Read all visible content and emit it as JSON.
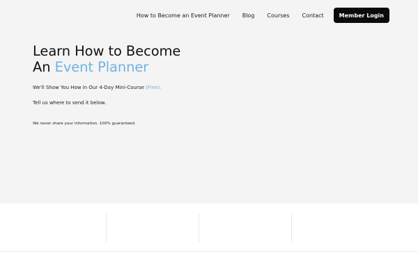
{
  "nav": {
    "links": [
      {
        "label": "How to Become an Event Planner"
      },
      {
        "label": "Blog"
      },
      {
        "label": "Courses"
      },
      {
        "label": "Contact"
      }
    ],
    "member_login": "Member Login"
  },
  "hero": {
    "headline_line1": "Learn How to Become",
    "headline_prefix": "An ",
    "headline_accent": "Event Planner",
    "subline_text": "We'll Show You How in Our 4-Day Mini-Course ",
    "subline_free": "(Free).",
    "tell_text": "Tell us where to send it below.",
    "privacy_text": "We never share your information. 100% guaranteed."
  },
  "colors": {
    "accent": "#6fb3e3",
    "hero_background": "#f4f4f4",
    "button_background": "#0b0b0b"
  }
}
